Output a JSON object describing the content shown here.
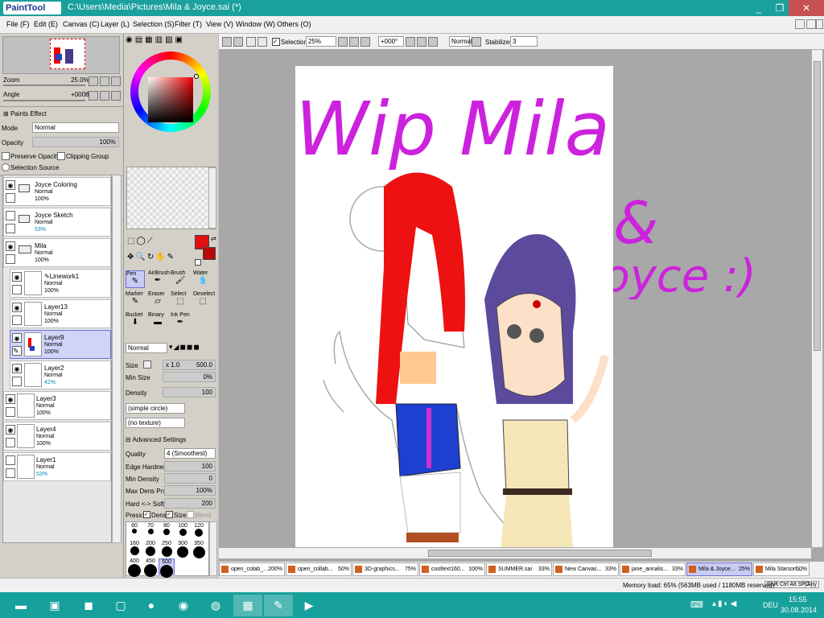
{
  "window": {
    "app_logo": "PaintTool SAI",
    "title": "C:\\Users\\Media\\Pictures\\Mila & Joyce.sai (*)",
    "minimize": "_",
    "restore": "❐",
    "close": "✕"
  },
  "menu": [
    "File (F)",
    "Edit (E)",
    "Canvas (C)",
    "Layer (L)",
    "Selection (S)",
    "Filter (T)",
    "View (V)",
    "Window (W)",
    "Others (O)"
  ],
  "navigator": {
    "zoom_label": "Zoom",
    "zoom_value": "25.0%",
    "angle_label": "Angle",
    "angle_value": "+0008"
  },
  "paint_effect": {
    "label": "Paints Effect",
    "mode_label": "Mode",
    "mode_value": "Normal",
    "opacity_label": "Opacity",
    "opacity_value": "100%",
    "preserve_opacity": "Preserve Opacity",
    "clipping_group": "Clipping Group",
    "selection_source": "Selection Source"
  },
  "layers": [
    {
      "name": "Joyce Coloring",
      "mode": "Normal",
      "opacity": "100%",
      "type": "folder",
      "visible": true
    },
    {
      "name": "Joyce Sketch",
      "mode": "Normal",
      "opacity": "53%",
      "type": "folder",
      "visible": false
    },
    {
      "name": "Mila",
      "mode": "Normal",
      "opacity": "100%",
      "type": "folder",
      "visible": true
    },
    {
      "name": "Linework1",
      "mode": "Normal",
      "opacity": "100%",
      "type": "layer",
      "visible": true
    },
    {
      "name": "Layer13",
      "mode": "Normal",
      "opacity": "100%",
      "type": "layer",
      "visible": true
    },
    {
      "name": "Layer9",
      "mode": "Normal",
      "opacity": "100%",
      "type": "layer",
      "visible": true,
      "selected": true
    },
    {
      "name": "Layer2",
      "mode": "Normal",
      "opacity": "42%",
      "type": "layer",
      "visible": true
    },
    {
      "name": "Layer3",
      "mode": "Normal",
      "opacity": "100%",
      "type": "layer",
      "visible": true
    },
    {
      "name": "Layer4",
      "mode": "Normal",
      "opacity": "100%",
      "type": "layer",
      "visible": true
    },
    {
      "name": "Layer1",
      "mode": "Normal",
      "opacity": "53%",
      "type": "layer",
      "visible": false
    }
  ],
  "tools": {
    "rows": [
      [
        "Pen",
        "AirBrush",
        "Brush",
        "Water"
      ],
      [
        "Marker",
        "Eraser",
        "Select",
        "Deselect"
      ],
      [
        "Bucket",
        "Binary",
        "Ink Pen",
        ""
      ]
    ],
    "selected": "Pen",
    "blend_mode": "Normal",
    "size_label": "Size",
    "size_mult": "x 1.0",
    "size_value": "500.0",
    "minsize_label": "Min Size",
    "minsize_value": "0%",
    "density_label": "Density",
    "density_value": "100",
    "shape": "(simple circle)",
    "texture": "(no texture)",
    "advanced": "Advanced Settings",
    "quality_label": "Quality",
    "quality_value": "4 (Smoothest)",
    "edge_label": "Edge Hardness",
    "edge_value": "100",
    "mindens_label": "Min Density",
    "mindens_value": "0",
    "maxdens_label": "Max Dens Prs.",
    "maxdens_value": "100%",
    "hardsoft_label": "Hard <-> Soft",
    "hardsoft_value": "200",
    "press_label": "Press:",
    "press_dens": "Dens",
    "press_size": "Size",
    "press_blend": "Blend",
    "brush_sizes": [
      "60",
      "70",
      "80",
      "100",
      "120",
      "160",
      "200",
      "250",
      "300",
      "350",
      "400",
      "450",
      "500"
    ],
    "selected_brush_size": "500"
  },
  "colors": {
    "primary": "#e01010",
    "secondary": "#b80808",
    "accent_purple": "#cc22dd"
  },
  "canvas_toolbar": {
    "selection_label": "Selection",
    "zoom": "25%",
    "angle": "+000°",
    "mode": "Normal",
    "stabilizer_label": "Stabilizer",
    "stabilizer_value": "3"
  },
  "artwork": {
    "line1": "Wip Mila",
    "line2": "&",
    "line3": "Joyce :)"
  },
  "tabs": [
    {
      "name": "open_colab_...",
      "pct": "200%"
    },
    {
      "name": "open_collab...",
      "pct": "50%"
    },
    {
      "name": "3D-graphics...",
      "pct": "75%"
    },
    {
      "name": "cooltext160...",
      "pct": "100%"
    },
    {
      "name": "SUMMER.sai",
      "pct": "33%"
    },
    {
      "name": "New Canvas...",
      "pct": "33%"
    },
    {
      "name": "jane_annalis...",
      "pct": "33%"
    },
    {
      "name": "Mila & Joyce...",
      "pct": "25%",
      "selected": true
    },
    {
      "name": "Mila Starson ...",
      "pct": "50%"
    }
  ],
  "status": {
    "memory": "Memory load: 65% (563MB used / 1180MB reserved)",
    "keys": "Shift Ctrl Alt SPC",
    "any": "Any"
  },
  "taskbar": {
    "icons": [
      "folder-icon",
      "network-icon",
      "pdf-icon",
      "remote-icon",
      "nero-icon",
      "chrome-icon",
      "firefox-icon",
      "paint-icon",
      "sai-icon",
      "media-icon"
    ],
    "lang": "DEU",
    "time": "15:55",
    "date": "30.08.2014"
  }
}
